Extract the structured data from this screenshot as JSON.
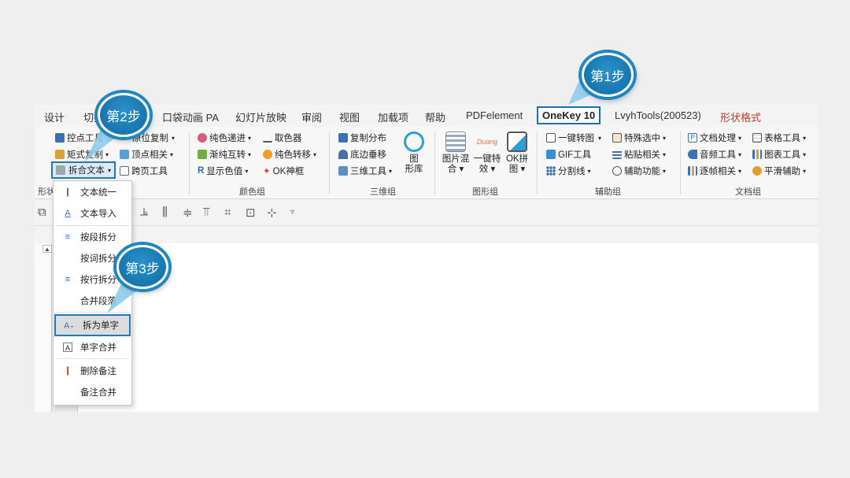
{
  "tabs": [
    "设计",
    "切换",
    "口袋动画 PA",
    "幻灯片放映",
    "审阅",
    "视图",
    "加载项",
    "帮助",
    "PDFelement",
    "OneKey 10",
    "LvyhTools(200523)",
    "形状格式"
  ],
  "active_tab": "OneKey 10",
  "ribbon": {
    "shape_group": {
      "items": [
        "控点工具",
        "矩式复制",
        "拆合文本",
        "原位复制",
        "顶点相关",
        "跨页工具"
      ],
      "label": "形状"
    },
    "color_group": {
      "items": [
        "纯色递进",
        "取色器",
        "渐纯互转",
        "纯色转移",
        "显示色值",
        "OK神框"
      ],
      "label": "颜色组"
    },
    "3d_group": {
      "items": [
        "复制分布",
        "底边垂移",
        "三维工具"
      ],
      "big": [
        "图",
        "形库"
      ],
      "label": "三维组"
    },
    "shape_graphics_group": {
      "big_items": [
        {
          "line1": "图片混",
          "line2": "合"
        },
        {
          "line1": "一键特",
          "line2": "效"
        },
        {
          "line1": "OK拼",
          "line2": "图"
        }
      ],
      "duang": "Duang",
      "label": "图形组"
    },
    "assist_group": {
      "items": [
        "一键转图",
        "特殊选中",
        "GIF工具",
        "粘贴相关",
        "分割线",
        "辅助功能"
      ],
      "label": "辅助组"
    },
    "doc_group": {
      "items": [
        "文档处理",
        "表格工具",
        "音频工具",
        "图表工具",
        "逐帧相关",
        "平滑辅助"
      ],
      "label": "文档组"
    }
  },
  "dropdown_button": "拆合文本",
  "menu": {
    "items": [
      "文本统一",
      "文本导入",
      "按段拆分",
      "按词拆分",
      "按行拆分",
      "合并段落",
      "拆为单字",
      "单字合并",
      "删除备注",
      "备注合并"
    ],
    "highlighted": "拆为单字"
  },
  "callouts": {
    "step1": "第1步",
    "step2": "第2步",
    "step3": "第3步"
  },
  "colors": {
    "callout": "#1d86c4",
    "highlight_border": "#1f7bb8",
    "accent_tab": "#c0392b"
  }
}
